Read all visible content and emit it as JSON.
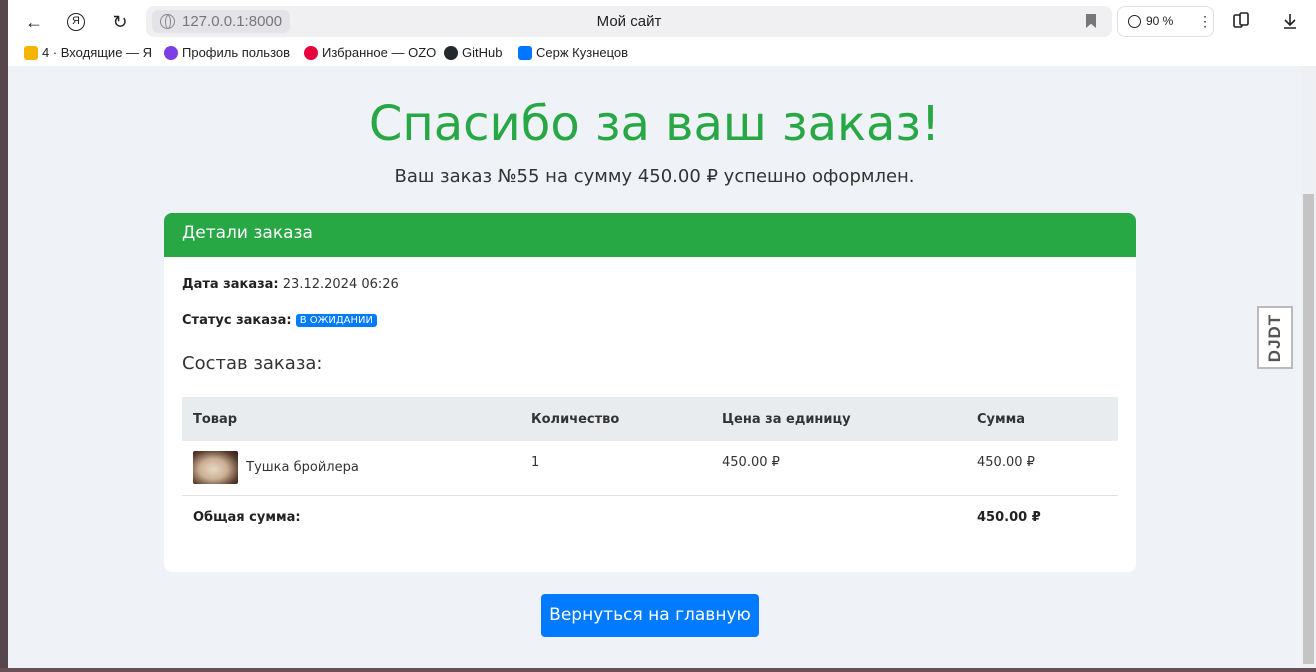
{
  "browser": {
    "url": "127.0.0.1:8000",
    "page_title": "Мой сайт",
    "zoom": "90 %"
  },
  "bookmarks": [
    {
      "label": "4 · Входящие — Я",
      "color": "#f5b400"
    },
    {
      "label": "Профиль пользов",
      "color": "#7b3fe4"
    },
    {
      "label": "Избранное — OZO",
      "color": "#e8003d"
    },
    {
      "label": "GitHub",
      "color": "#24292e"
    },
    {
      "label": "Серж Кузнецов",
      "color": "#0077ff"
    }
  ],
  "page": {
    "heading": "Спасибо за ваш заказ!",
    "summary": "Ваш заказ №55 на сумму 450.00 ₽ успешно оформлен.",
    "card_title": "Детали заказа",
    "date_label": "Дата заказа:",
    "date_value": "23.12.2024 06:26",
    "status_label": "Статус заказа:",
    "status_value": "В ОЖИДАНИИ",
    "section_title": "Состав заказа:",
    "table": {
      "headers": [
        "Товар",
        "Количество",
        "Цена за единицу",
        "Сумма"
      ],
      "rows": [
        {
          "product": "Тушка бройлера",
          "qty": "1",
          "price": "450.00 ₽",
          "sum": "450.00 ₽"
        }
      ],
      "total_label": "Общая сумма:",
      "total_value": "450.00 ₽"
    },
    "home_button": "Вернуться на главную",
    "djdt_label": "DJDT"
  },
  "colors": {
    "success": "#28a745",
    "primary": "#007bff"
  }
}
